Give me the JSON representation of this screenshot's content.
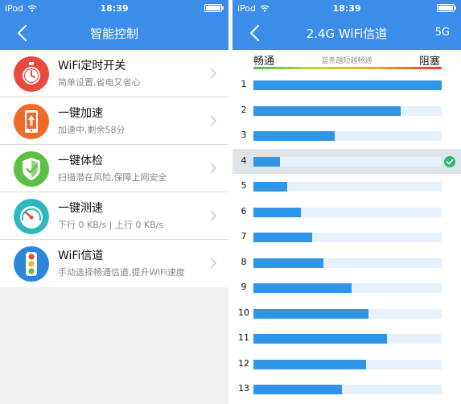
{
  "status_bar": {
    "carrier": "iPod",
    "time": "18:39",
    "battery_level": 1.0
  },
  "colors": {
    "header": "#3c8dea",
    "bar_fill": "#2f95e8",
    "bar_track": "#e6f1fb",
    "selected_row": "#dfe3ea",
    "check": "#2bb673"
  },
  "left_screen": {
    "title": "智能控制",
    "items": [
      {
        "icon": "stopwatch-icon",
        "icon_color": "#e84a3f",
        "title": "WiFi定时开关",
        "subtitle": "简单设置,省电又省心"
      },
      {
        "icon": "phone-speedup-icon",
        "icon_color": "#f06b2a",
        "title": "一键加速",
        "subtitle": "加速中,剩余58分"
      },
      {
        "icon": "shield-check-icon",
        "icon_color": "#5bc043",
        "title": "一键体检",
        "subtitle": "扫描潜在风险,保障上网安全"
      },
      {
        "icon": "speedometer-icon",
        "icon_color": "#2fb7c0",
        "title": "一键测速",
        "subtitle": "下行 0 KB/s | 上行 0 KB/s"
      },
      {
        "icon": "traffic-light-icon",
        "icon_color": "#2c86d9",
        "title": "WiFi信道",
        "subtitle": "手动选择畅通信道,提升WiFi速度"
      }
    ]
  },
  "right_screen": {
    "title": "2.4G WiFi信道",
    "band_toggle": "5G",
    "legend": {
      "good": "畅通",
      "hint": "蓝条越短越畅通",
      "bad": "阻塞"
    },
    "selected_channel": "4",
    "channels": [
      {
        "label": "1",
        "level": 1.0
      },
      {
        "label": "2",
        "level": 0.78
      },
      {
        "label": "3",
        "level": 0.43
      },
      {
        "label": "4",
        "level": 0.14
      },
      {
        "label": "5",
        "level": 0.18
      },
      {
        "label": "6",
        "level": 0.25
      },
      {
        "label": "7",
        "level": 0.31
      },
      {
        "label": "8",
        "level": 0.37
      },
      {
        "label": "9",
        "level": 0.52
      },
      {
        "label": "10",
        "level": 0.61
      },
      {
        "label": "11",
        "level": 0.71
      },
      {
        "label": "12",
        "level": 0.6
      },
      {
        "label": "13",
        "level": 0.47
      }
    ]
  }
}
